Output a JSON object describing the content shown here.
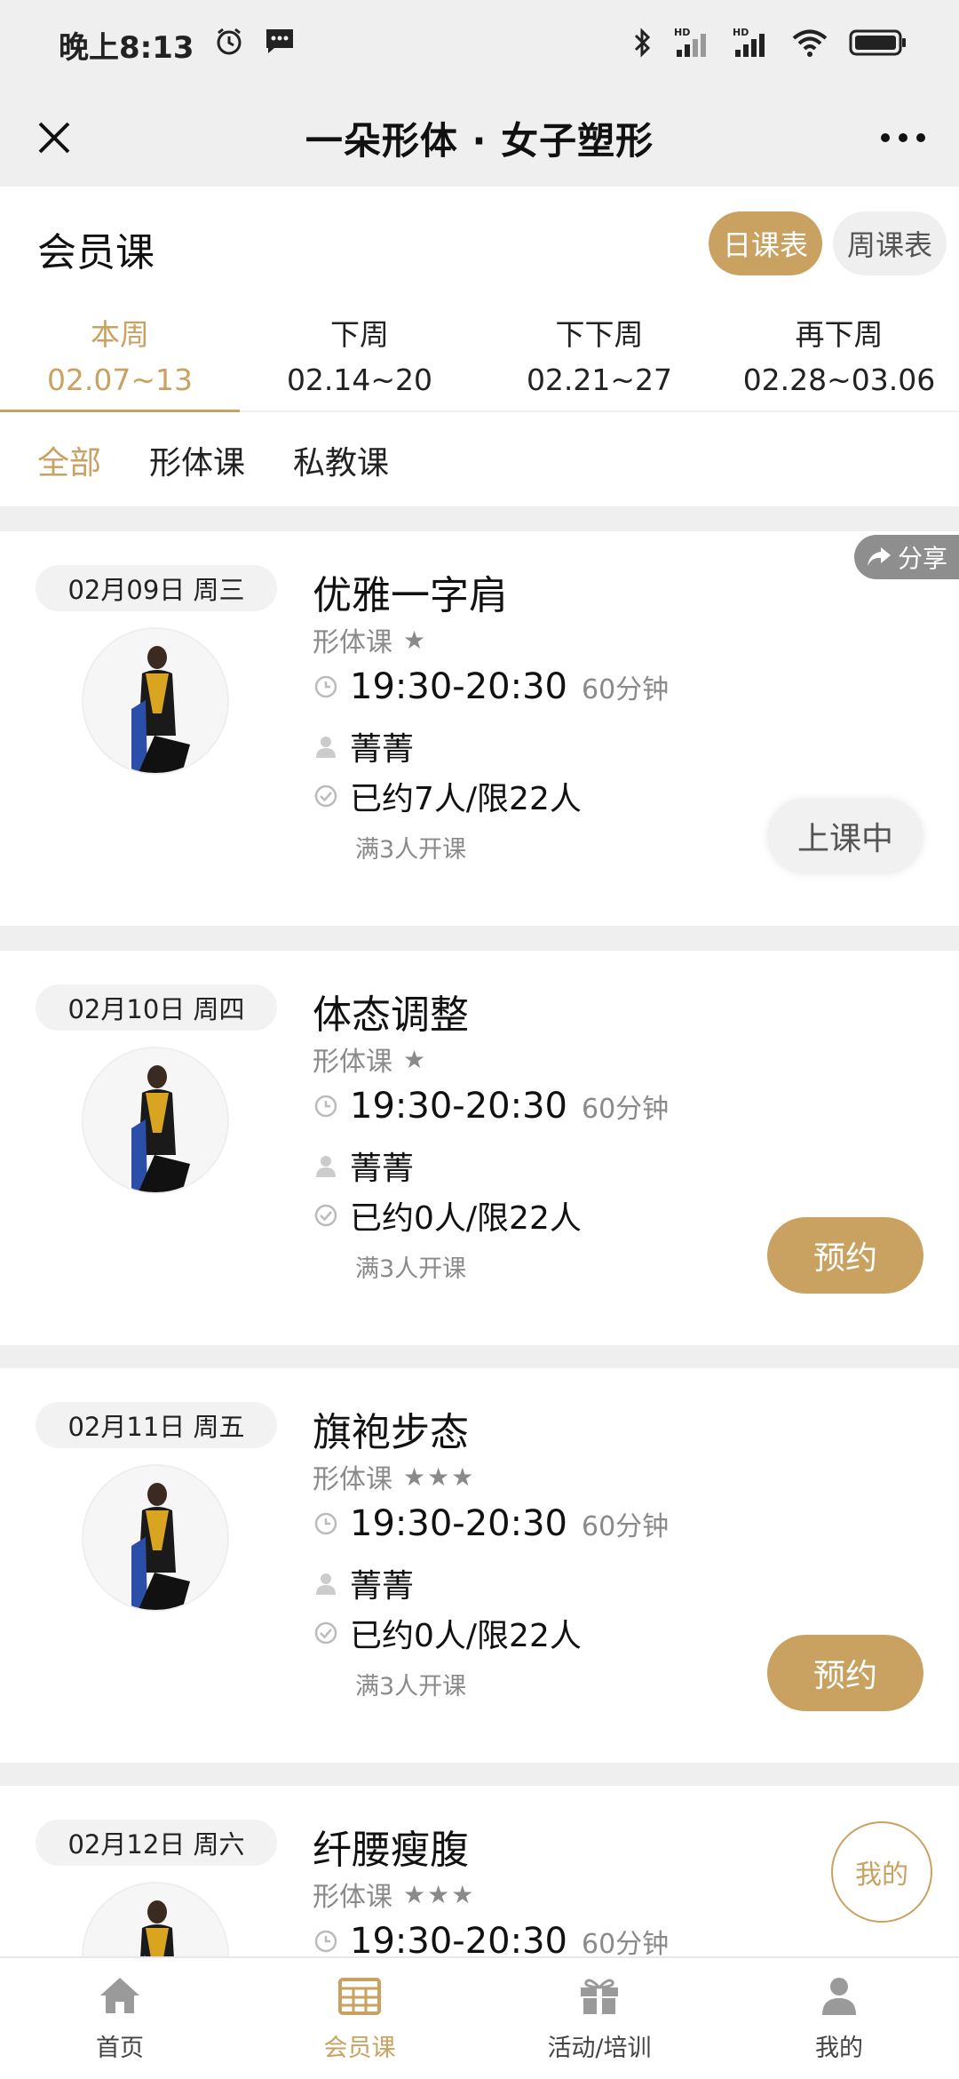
{
  "status": {
    "time": "晚上8:13",
    "hd1": "HD",
    "hd2": "HD"
  },
  "app": {
    "title": "一朵形体 · 女子塑形"
  },
  "section": {
    "title": "会员课"
  },
  "view_toggle": [
    {
      "label": "日课表",
      "active": true
    },
    {
      "label": "周课表",
      "active": false
    }
  ],
  "weeks": [
    {
      "label": "本周",
      "range": "02.07~13",
      "active": true
    },
    {
      "label": "下周",
      "range": "02.14~20",
      "active": false
    },
    {
      "label": "下下周",
      "range": "02.21~27",
      "active": false
    },
    {
      "label": "再下周",
      "range": "02.28~03.06",
      "active": false
    }
  ],
  "categories": [
    {
      "label": "全部",
      "active": true
    },
    {
      "label": "形体课",
      "active": false
    },
    {
      "label": "私教课",
      "active": false
    }
  ],
  "share_label": "分享",
  "cards": [
    {
      "date": "02月09日 周三",
      "name": "优雅一字肩",
      "type": "形体课",
      "stars": "★",
      "time": "19:30-20:30",
      "duration": "60分钟",
      "teacher": "菁菁",
      "booked": "已约7人/限22人",
      "min_open": "满3人开课",
      "action": "上课中",
      "action_type": "ongoing"
    },
    {
      "date": "02月10日 周四",
      "name": "体态调整",
      "type": "形体课",
      "stars": "★",
      "time": "19:30-20:30",
      "duration": "60分钟",
      "teacher": "菁菁",
      "booked": "已约0人/限22人",
      "min_open": "满3人开课",
      "action": "预约",
      "action_type": "book"
    },
    {
      "date": "02月11日 周五",
      "name": "旗袍步态",
      "type": "形体课",
      "stars": "★★★",
      "time": "19:30-20:30",
      "duration": "60分钟",
      "teacher": "菁菁",
      "booked": "已约0人/限22人",
      "min_open": "满3人开课",
      "action": "预约",
      "action_type": "book"
    },
    {
      "date": "02月12日 周六",
      "name": "纤腰瘦腹",
      "type": "形体课",
      "stars": "★★★",
      "time": "19:30-20:30",
      "duration": "60分钟",
      "stamp": "我的"
    }
  ],
  "nav": [
    {
      "label": "首页",
      "icon": "home-icon",
      "active": false
    },
    {
      "label": "会员课",
      "icon": "calendar-icon",
      "active": true
    },
    {
      "label": "活动/培训",
      "icon": "gift-icon",
      "active": false
    },
    {
      "label": "我的",
      "icon": "user-icon",
      "active": false
    }
  ],
  "colors": {
    "accent": "#c9a262",
    "background": "#efefef",
    "muted": "#8a8a8a"
  }
}
